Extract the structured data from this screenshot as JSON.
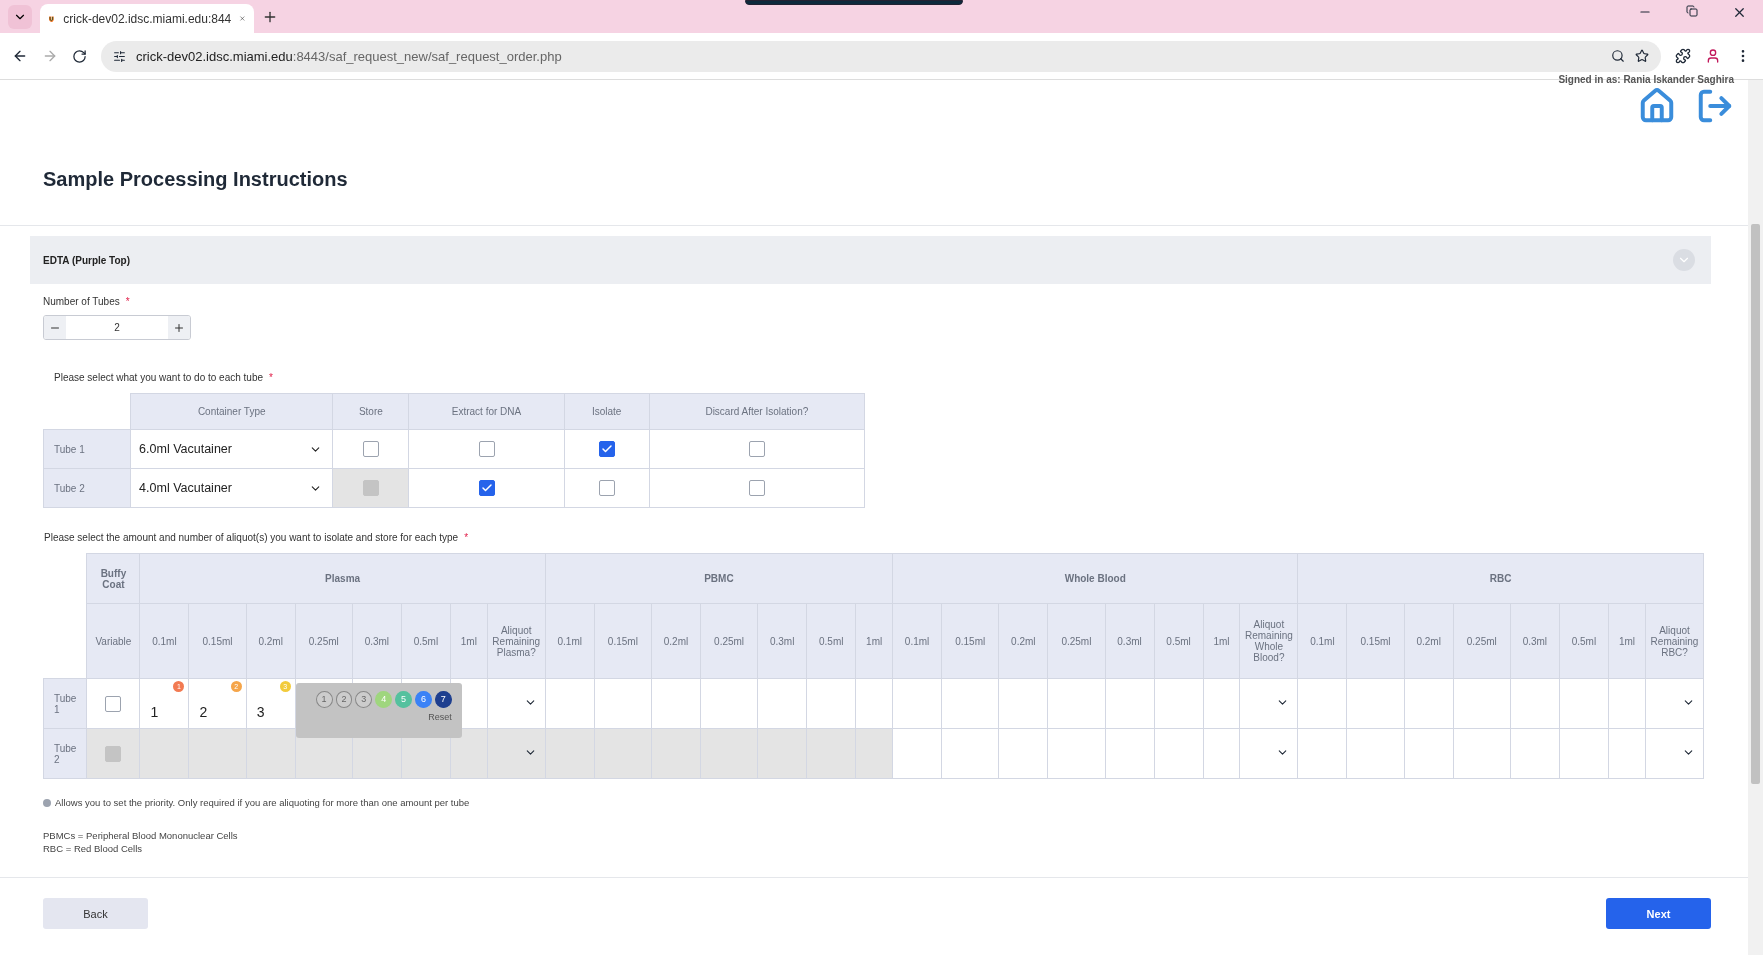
{
  "browser": {
    "tab_title": "crick-dev02.idsc.miami.edu:844",
    "url_host": "crick-dev02.idsc.miami.edu",
    "url_path": ":8443/saf_request_new/saf_request_order.php"
  },
  "header": {
    "signed_in": "Signed in as: Rania Iskander Saghira",
    "title": "Sample Processing Instructions"
  },
  "section": {
    "title": "EDTA (Purple Top)"
  },
  "tube_count": {
    "label": "Number of Tubes",
    "required_mark": "*",
    "value": "2"
  },
  "tube_table": {
    "prompt": "Please select what you want to do to each tube",
    "required_mark": "*",
    "columns": [
      "Container Type",
      "Store",
      "Extract for DNA",
      "Isolate",
      "Discard After Isolation?"
    ],
    "rows": [
      {
        "label": "Tube 1",
        "container": "6.0ml Vacutainer",
        "options": [
          {
            "checked": false,
            "disabled": false
          },
          {
            "checked": false,
            "disabled": false
          },
          {
            "checked": true,
            "disabled": false
          },
          {
            "checked": false,
            "disabled": false
          }
        ]
      },
      {
        "label": "Tube 2",
        "container": "4.0ml Vacutainer",
        "options": [
          {
            "checked": false,
            "disabled": true
          },
          {
            "checked": true,
            "disabled": false
          },
          {
            "checked": false,
            "disabled": false
          },
          {
            "checked": false,
            "disabled": false
          }
        ]
      }
    ]
  },
  "aliquot_table": {
    "prompt": "Please select the amount and number of aliquot(s) you want to isolate and store for each type",
    "required_mark": "*",
    "buffy": {
      "label": "Buffy Coat",
      "column": "Variable"
    },
    "groups": [
      {
        "label": "Plasma",
        "columns": [
          "0.1ml",
          "0.15ml",
          "0.2ml",
          "0.25ml",
          "0.3ml",
          "0.5ml",
          "1ml",
          "Aliquot Remaining Plasma?"
        ]
      },
      {
        "label": "PBMC",
        "columns": [
          "0.1ml",
          "0.15ml",
          "0.2ml",
          "0.25ml",
          "0.3ml",
          "0.5ml",
          "1ml"
        ]
      },
      {
        "label": "Whole Blood",
        "columns": [
          "0.1ml",
          "0.15ml",
          "0.2ml",
          "0.25ml",
          "0.3ml",
          "0.5ml",
          "1ml",
          "Aliquot Remaining Whole Blood?"
        ]
      },
      {
        "label": "RBC",
        "columns": [
          "0.1ml",
          "0.15ml",
          "0.2ml",
          "0.25ml",
          "0.3ml",
          "0.5ml",
          "1ml",
          "Aliquot Remaining RBC?"
        ]
      }
    ],
    "rows": [
      {
        "label": "Tube 1",
        "buffy": {
          "checked": false,
          "disabled": false
        },
        "groups": [
          {
            "disabled": false,
            "amounts": [
              {
                "value": "1",
                "priority": "1",
                "color": "#f27a52"
              },
              {
                "value": "2",
                "priority": "2",
                "color": "#f5a54a"
              },
              {
                "value": "3",
                "priority": "3",
                "color": "#f2cb3c"
              }
            ],
            "picker": {
              "options": [
                {
                  "label": "1",
                  "color": "#cccccc"
                },
                {
                  "label": "2",
                  "color": "#cccccc"
                },
                {
                  "label": "3",
                  "color": "#cccccc"
                },
                {
                  "label": "4",
                  "color": "#9fd67e"
                },
                {
                  "label": "5",
                  "color": "#55c19e"
                },
                {
                  "label": "6",
                  "color": "#3b82f6"
                },
                {
                  "label": "7",
                  "color": "#1e3f8f"
                }
              ],
              "reset": "Reset"
            }
          },
          {
            "disabled": false
          },
          {
            "disabled": false
          },
          {
            "disabled": false
          }
        ]
      },
      {
        "label": "Tube 2",
        "buffy": {
          "checked": false,
          "disabled": true
        },
        "groups": [
          {
            "disabled": true
          },
          {
            "disabled": true
          },
          {
            "disabled": false
          },
          {
            "disabled": false
          }
        ]
      }
    ]
  },
  "notes": {
    "priority_hint": "Allows you to set the priority. Only required if you are aliquoting for more than one amount per tube",
    "abbreviations": [
      "PBMCs = Peripheral Blood Mononuclear Cells",
      "RBC = Red Blood Cells"
    ]
  },
  "buttons": {
    "back": "Back",
    "next": "Next"
  }
}
